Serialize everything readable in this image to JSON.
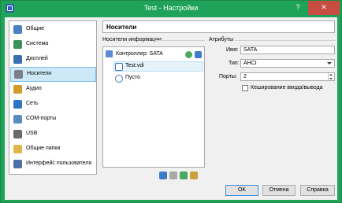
{
  "window": {
    "title": "Test - Настройки",
    "help_glyph": "?",
    "close_glyph": "✕",
    "colors": {
      "titlebar": "#1fa35a",
      "close": "#c74d43",
      "selection": "#cde8f6",
      "selection_border": "#7ec0e6"
    }
  },
  "sidebar": {
    "items": [
      {
        "label": "Общие",
        "icon": "general-icon",
        "color": "#4a7fc1"
      },
      {
        "label": "Система",
        "icon": "motherboard-icon",
        "color": "#3f8f5a"
      },
      {
        "label": "Дисплей",
        "icon": "monitor-icon",
        "color": "#3a6fb0"
      },
      {
        "label": "Носители",
        "icon": "storage-icon",
        "color": "#7a7f88",
        "selected": true
      },
      {
        "label": "Аудио",
        "icon": "speaker-icon",
        "color": "#d29a2a"
      },
      {
        "label": "Сеть",
        "icon": "network-icon",
        "color": "#2e73c4"
      },
      {
        "label": "COM-порты",
        "icon": "serial-port-icon",
        "color": "#5a8dbf"
      },
      {
        "label": "USB",
        "icon": "usb-icon",
        "color": "#6b6b6b"
      },
      {
        "label": "Общие папки",
        "icon": "shared-folder-icon",
        "color": "#e0b64a"
      },
      {
        "label": "Интерфейс пользователя",
        "icon": "user-interface-icon",
        "color": "#4c6fa8"
      }
    ]
  },
  "page": {
    "title": "Носители"
  },
  "storage": {
    "group_label": "Носители информации",
    "controller": {
      "label": "Контроллер: SATA",
      "icon": "sata-controller-icon"
    },
    "devices": [
      {
        "label": "Test.vdi",
        "icon": "hard-disk-icon"
      },
      {
        "label": "Пусто",
        "icon": "optical-disc-icon"
      }
    ],
    "controller_actions": [
      "add-optical-drive-icon",
      "add-hard-disk-icon"
    ],
    "toolbar": [
      "add-controller-icon",
      "remove-controller-icon",
      "add-attachment-icon",
      "remove-attachment-icon"
    ]
  },
  "attributes": {
    "group_label": "Атрибуты",
    "name_label": "Имя:",
    "name_value": "SATA",
    "type_label": "Тип:",
    "type_value": "AHCI",
    "ports_label": "Порты:",
    "ports_value": "2",
    "cache_label": "Кеширование ввода/вывода",
    "cache_checked": false
  },
  "buttons": {
    "ok": "OK",
    "cancel": "Отмена",
    "help": "Справка"
  }
}
